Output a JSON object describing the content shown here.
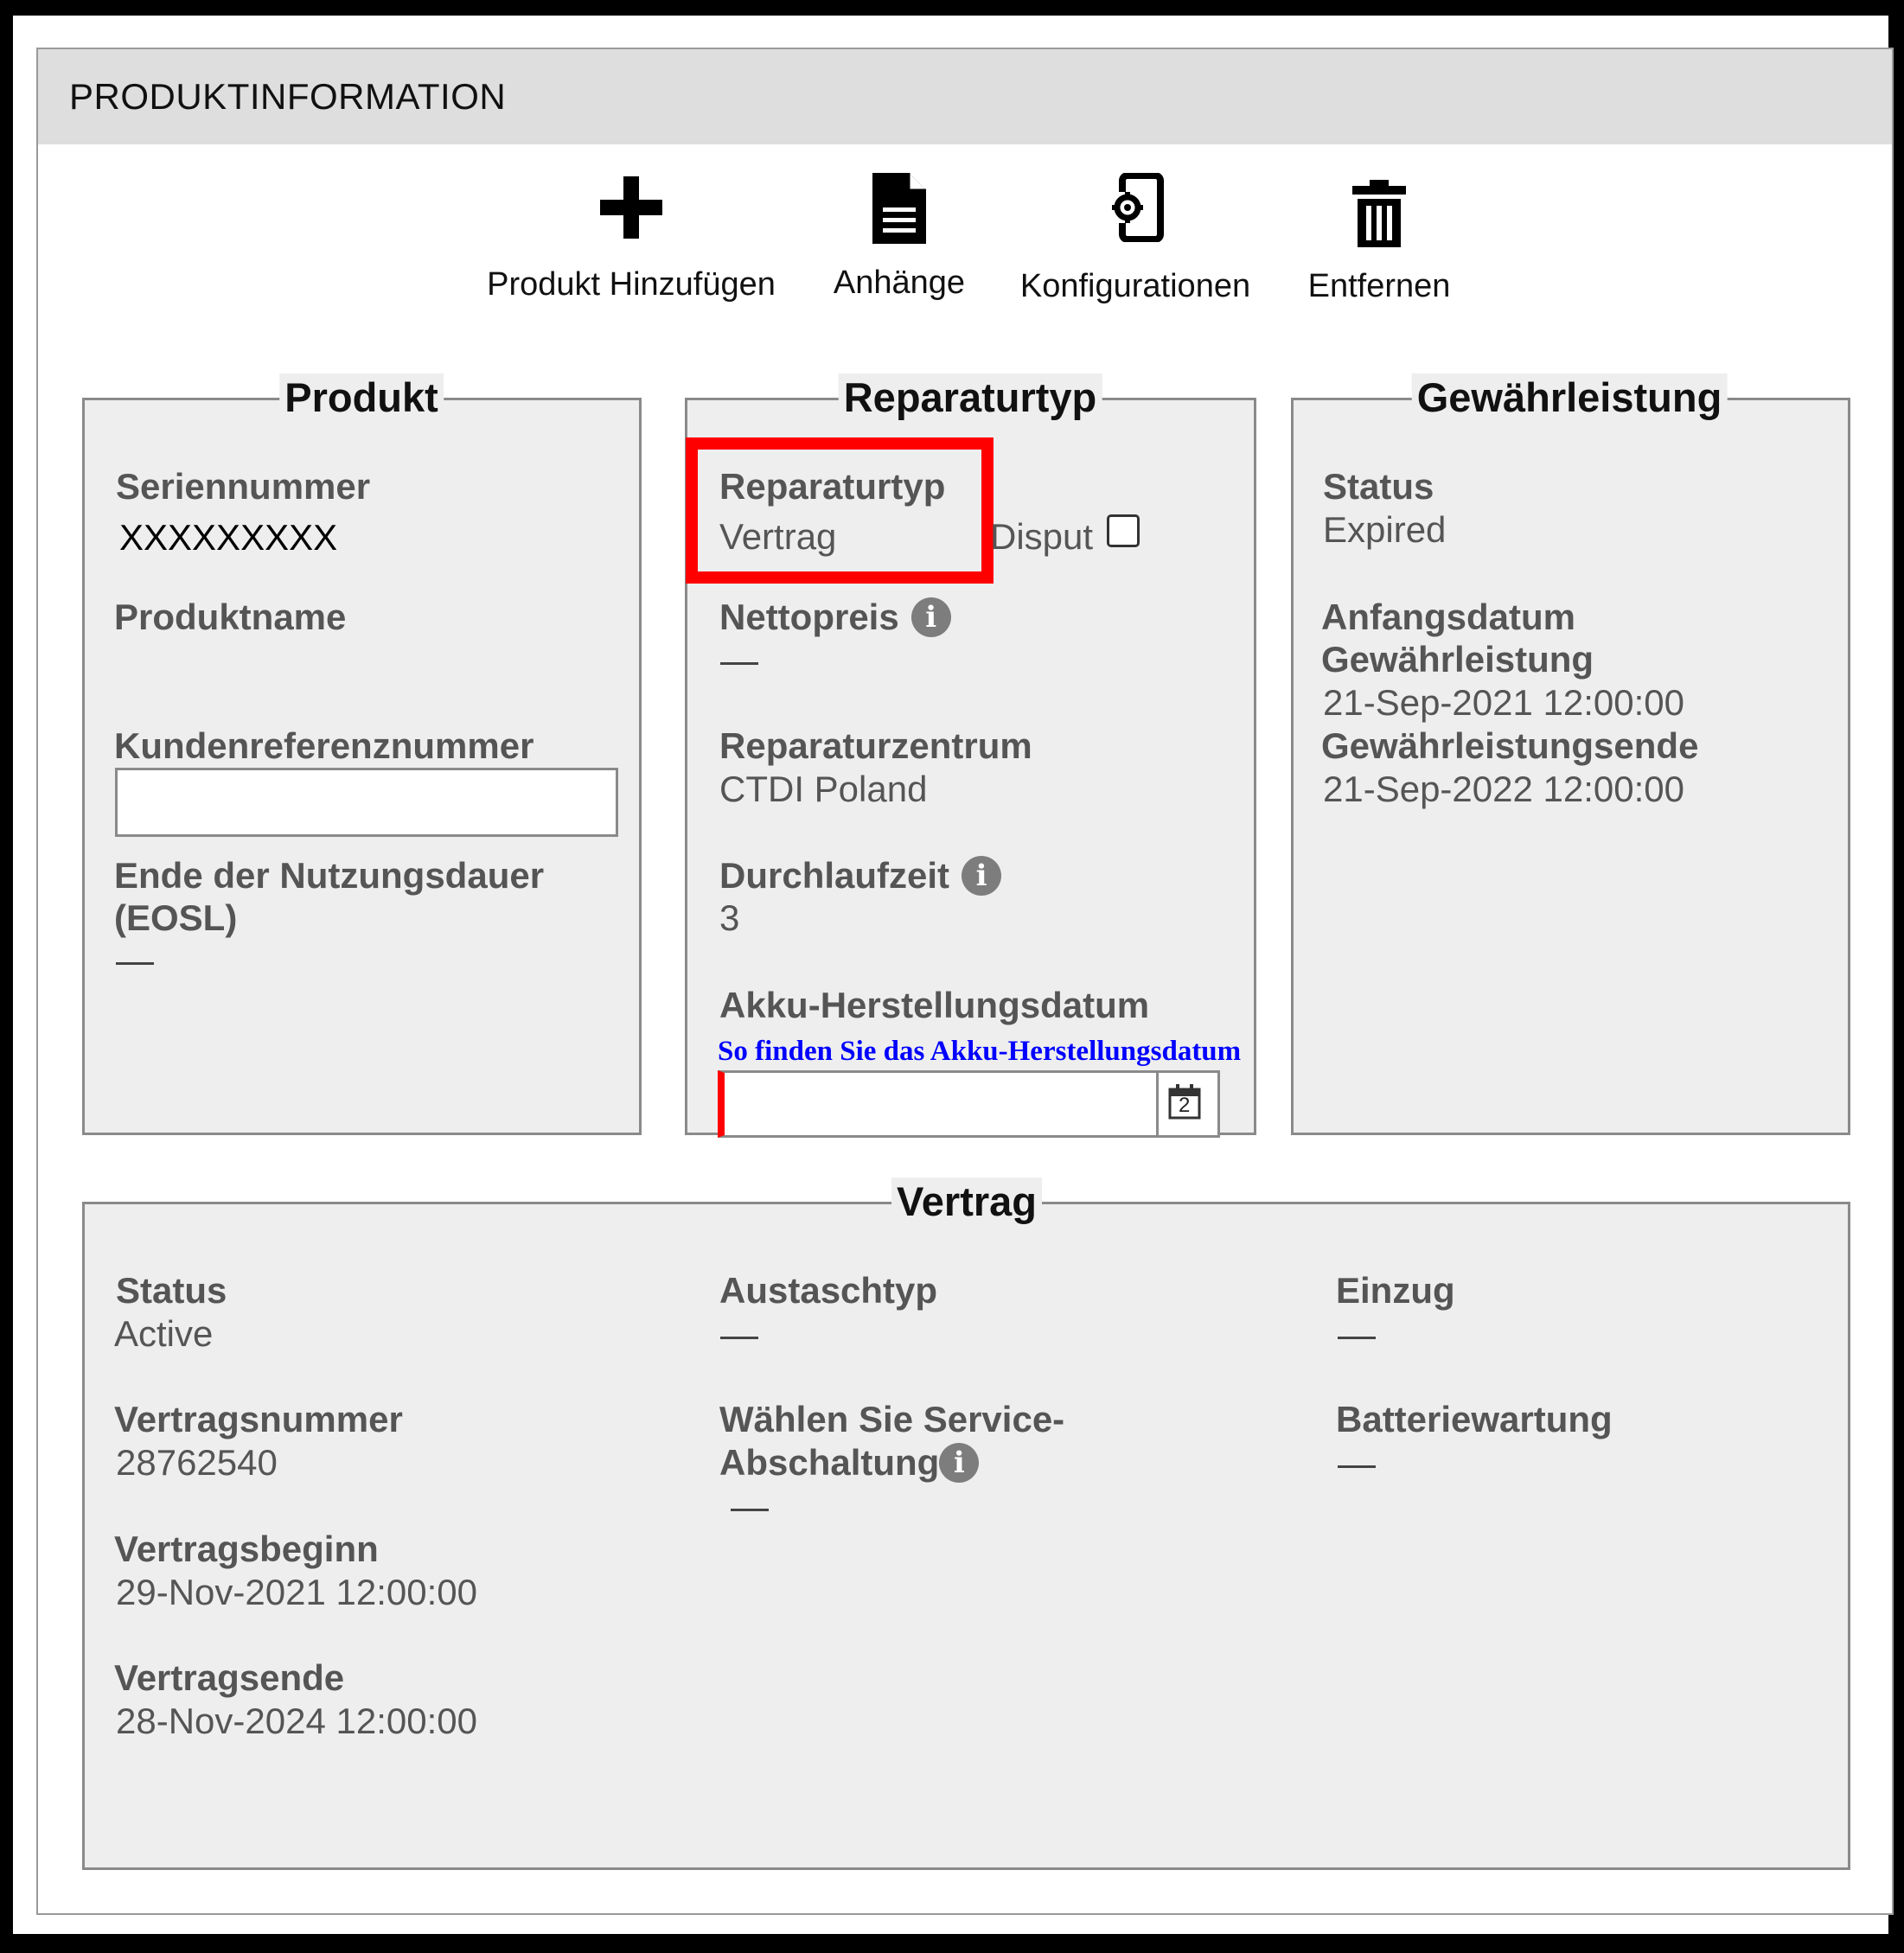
{
  "header": {
    "title": "PRODUKTINFORMATION"
  },
  "toolbar": {
    "add_product": "Produkt Hinzufügen",
    "attachments": "Anhänge",
    "configurations": "Konfigurationen",
    "remove": "Entfernen"
  },
  "produkt": {
    "legend": "Produkt",
    "serial_label": "Seriennummer",
    "serial_value": "XXXXXXXXX",
    "name_label": "Produktname",
    "customer_ref_label": "Kundenreferenznummer",
    "customer_ref_value": "",
    "eosl_label_line1": "Ende der Nutzungsdauer",
    "eosl_label_line2": "(EOSL)",
    "eosl_value": "—"
  },
  "reparaturtyp": {
    "legend": "Reparaturtyp",
    "type_label": "Reparaturtyp",
    "type_value": "Vertrag",
    "disput_label": "Disput",
    "net_price_label": "Nettopreis",
    "net_price_value": "—",
    "center_label": "Reparaturzentrum",
    "center_value": "CTDI Poland",
    "lead_time_label": "Durchlaufzeit",
    "lead_time_value": "3",
    "battery_date_label": "Akku-Herstellungsdatum",
    "battery_date_link": "So finden Sie das Akku-Herstellungsdatum",
    "battery_date_value": "",
    "calendar_day": "2"
  },
  "gewaehrleistung": {
    "legend": "Gewährleistung",
    "status_label": "Status",
    "status_value": "Expired",
    "start_label_line1": "Anfangsdatum",
    "start_label_line2": "Gewährleistung",
    "start_value": "21-Sep-2021 12:00:00",
    "end_label": "Gewährleistungsende",
    "end_value": "21-Sep-2022 12:00:00"
  },
  "vertrag": {
    "legend": "Vertrag",
    "status_label": "Status",
    "status_value": "Active",
    "number_label": "Vertragsnummer",
    "number_value": "28762540",
    "start_label": "Vertragsbeginn",
    "start_value": "29-Nov-2021 12:00:00",
    "end_label": "Vertragsende",
    "end_value": "28-Nov-2024 12:00:00",
    "exchange_type_label": "Austaschtyp",
    "exchange_type_value": "—",
    "service_label_line1": "Wählen Sie Service-",
    "service_label_line2": "Abschaltung",
    "service_value": "—",
    "collection_label": "Einzug",
    "collection_value": "—",
    "battery_service_label": "Batteriewartung",
    "battery_service_value": "—"
  },
  "colors": {
    "highlight": "#ff0000",
    "link": "#0000ff",
    "section_bg": "#eeeeee",
    "header_bg": "#dedede"
  },
  "icons": [
    "plus-icon",
    "document-icon",
    "phone-settings-icon",
    "trash-icon",
    "info-icon",
    "calendar-icon"
  ]
}
